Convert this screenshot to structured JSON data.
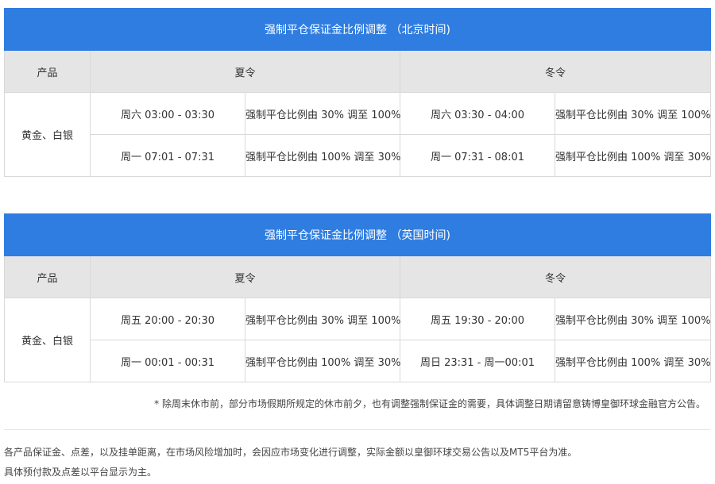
{
  "tables": [
    {
      "title": "强制平仓保证金比例调整 （北京时间)",
      "col_product": "产品",
      "col_summer": "夏令",
      "col_winter": "冬令",
      "product": "黄金、白银",
      "rows": [
        {
          "summer_time": "周六 03:00 - 03:30",
          "summer_adj": "强制平仓比例由 30% 调至 100%",
          "winter_time": "周六 03:30 - 04:00",
          "winter_adj": "强制平仓比例由 30% 调至 100%"
        },
        {
          "summer_time": "周一 07:01 - 07:31",
          "summer_adj": "强制平仓比例由 100% 调至 30%",
          "winter_time": "周一 07:31 - 08:01",
          "winter_adj": "强制平仓比例由 100% 调至 30%"
        }
      ]
    },
    {
      "title": "强制平仓保证金比例调整 （英国时间)",
      "col_product": "产品",
      "col_summer": "夏令",
      "col_winter": "冬令",
      "product": "黄金、白银",
      "rows": [
        {
          "summer_time": "周五 20:00 - 20:30",
          "summer_adj": "强制平仓比例由 30% 调至 100%",
          "winter_time": "周五 19:30 - 20:00",
          "winter_adj": "强制平仓比例由 30% 调至 100%"
        },
        {
          "summer_time": "周一 00:01 - 00:31",
          "summer_adj": "强制平仓比例由 100% 调至 30%",
          "winter_time": "周日 23:31 - 周一00:01",
          "winter_adj": "强制平仓比例由 100% 调至 30%"
        }
      ]
    }
  ],
  "note": "* 除周末休市前，部分市场假期所规定的休市前夕，也有调整强制保证金的需要，具体调整日期请留意铸博皇御环球金融官方公告。",
  "footer": [
    "各产品保证金、点差，以及挂单距离，在市场风险增加时，会因应市场变化进行调整，实际金额以皇御环球交易公告以及MT5平台为准。",
    "具体预付款及点差以平台显示为主。"
  ],
  "colors": {
    "title_bg": "#2f7de1",
    "header_bg": "#e5e5e5",
    "border": "#d9d9d9"
  }
}
